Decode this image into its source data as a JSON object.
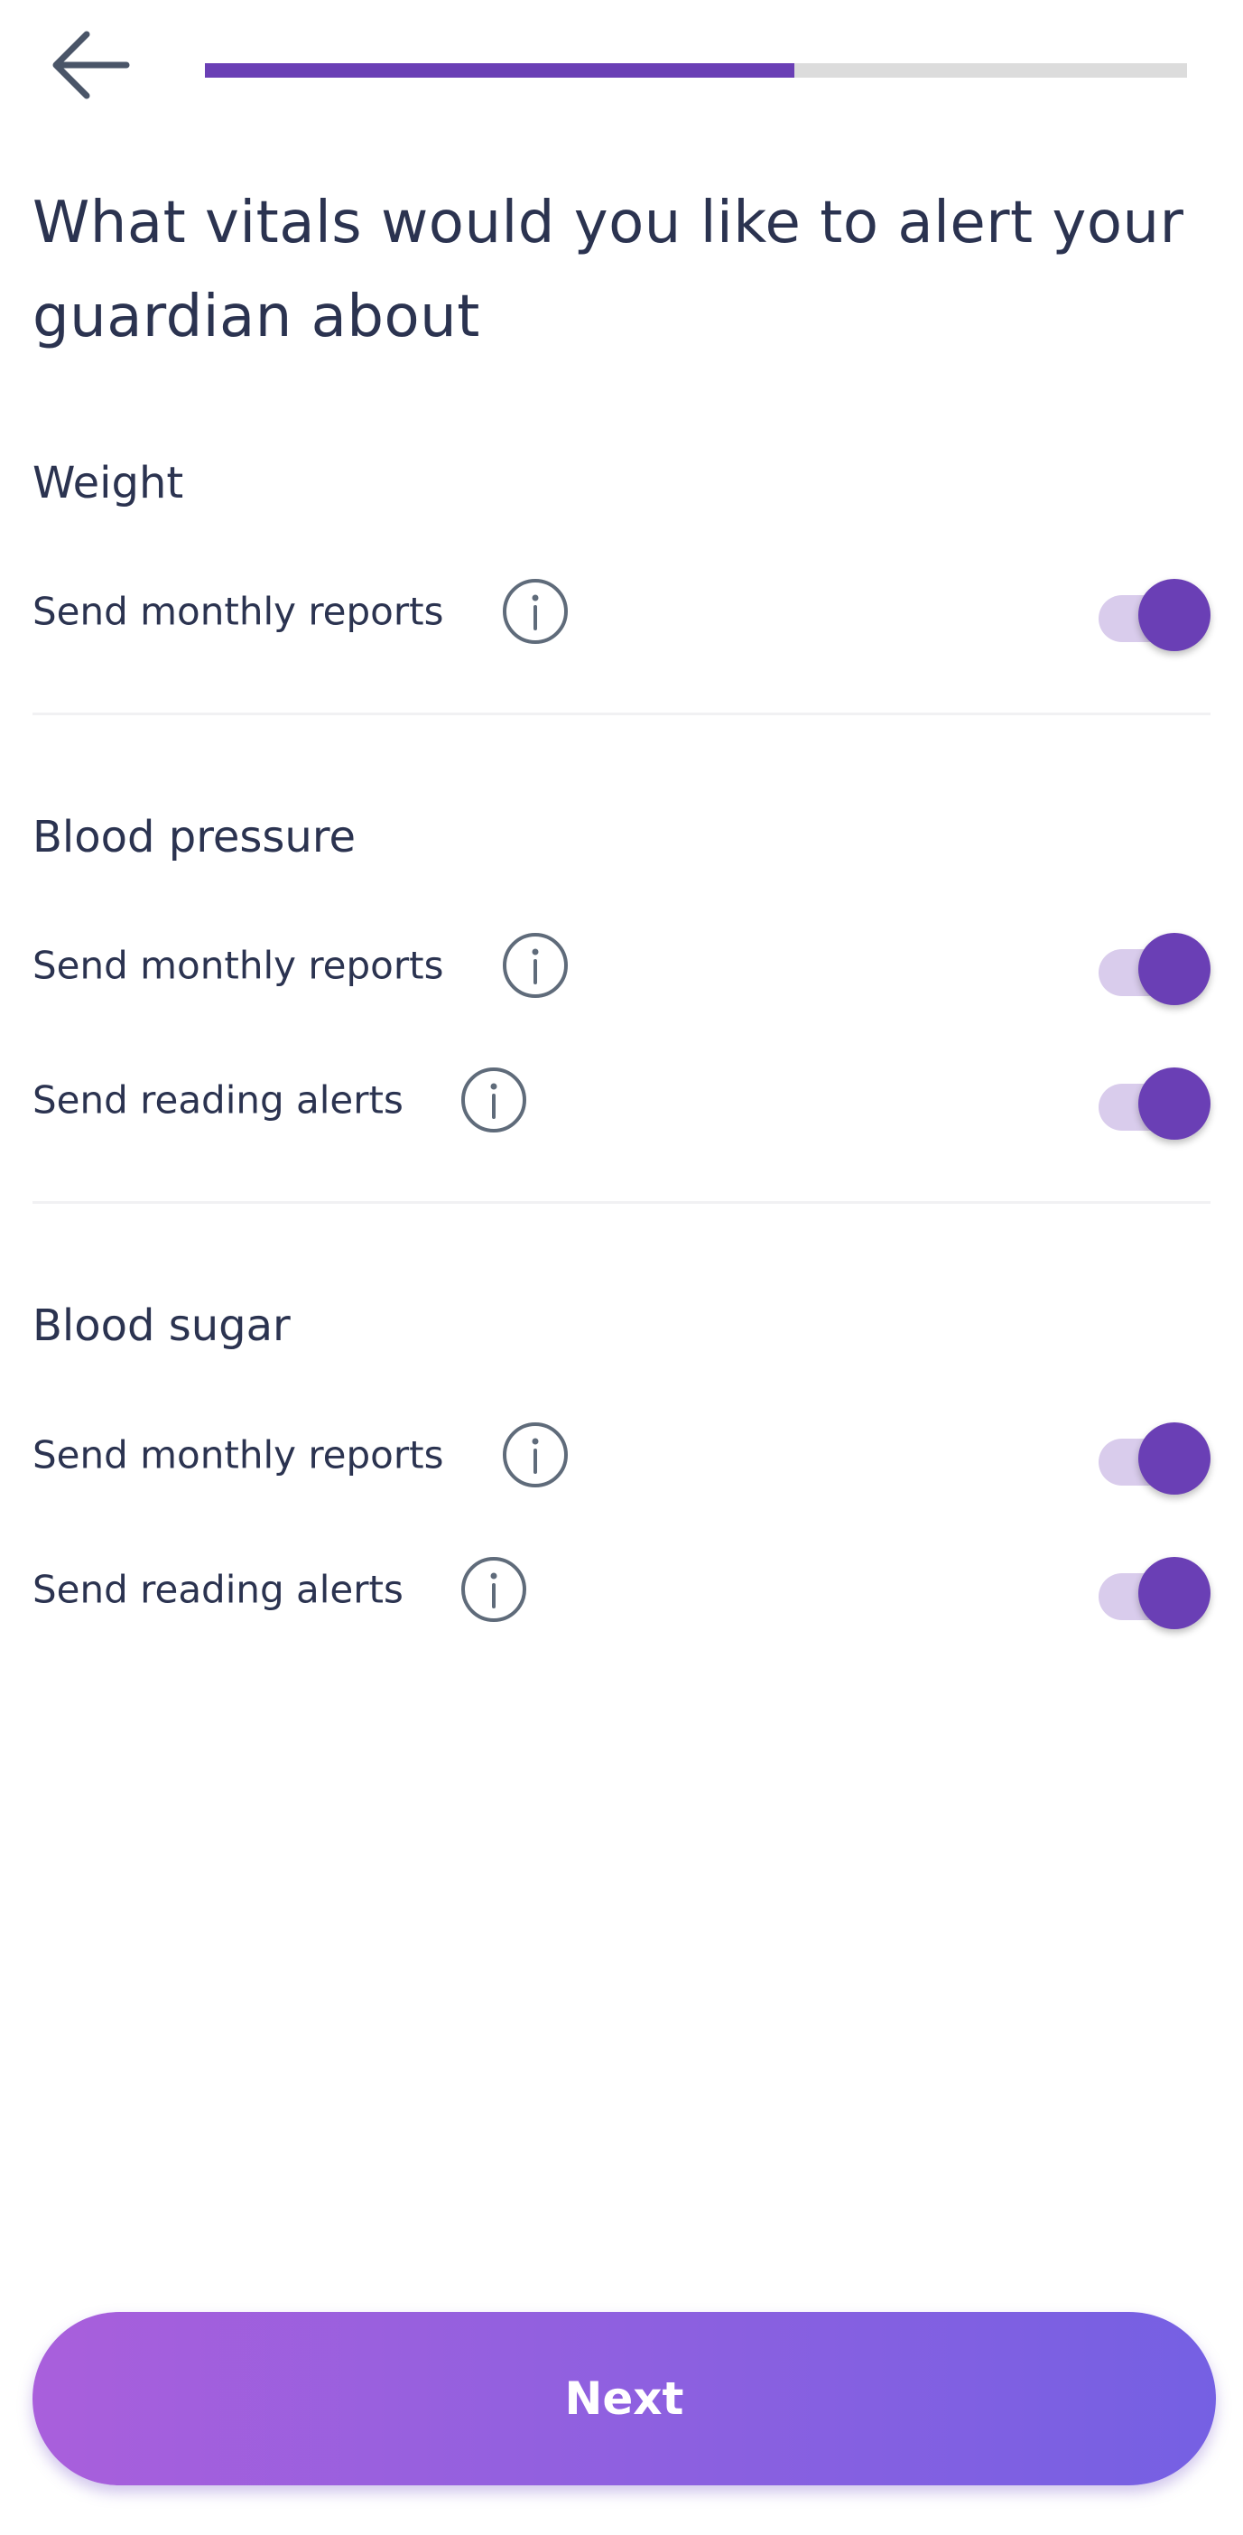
{
  "header": {
    "back_icon": "arrow-left-icon",
    "progress_fraction": 0.6
  },
  "title": "What vitals would you like to alert your guardian about",
  "sections": [
    {
      "title": "Weight",
      "rows": [
        {
          "label": "Send monthly reports",
          "info_icon": "info-circle-icon",
          "enabled": true
        }
      ]
    },
    {
      "title": "Blood pressure",
      "rows": [
        {
          "label": "Send monthly reports",
          "info_icon": "info-circle-icon",
          "enabled": true
        },
        {
          "label": "Send reading alerts",
          "info_icon": "info-circle-icon",
          "enabled": true
        }
      ]
    },
    {
      "title": "Blood sugar",
      "rows": [
        {
          "label": "Send monthly reports",
          "info_icon": "info-circle-icon",
          "enabled": true
        },
        {
          "label": "Send reading alerts",
          "info_icon": "info-circle-icon",
          "enabled": true
        }
      ]
    }
  ],
  "next_label": "Next",
  "colors": {
    "accent": "#6a3fb5",
    "track_on": "#d9ccec",
    "text": "#2b3350",
    "progress_bg": "#dcdcdc"
  }
}
